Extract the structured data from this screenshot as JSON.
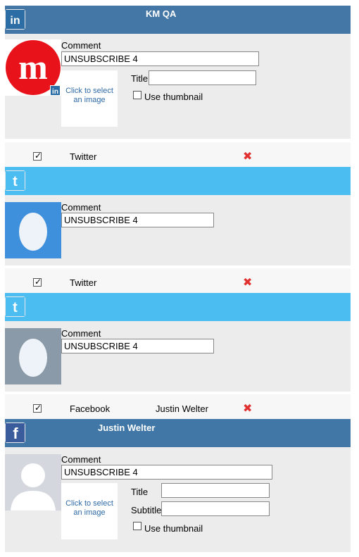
{
  "colors": {
    "linkedin_header": "#4477a5",
    "twitter_header": "#4bbdf0",
    "facebook_header": "#4077a6",
    "panel_bg": "#ececec",
    "remove_icon": "#e03030",
    "link_text": "#2e6aa6"
  },
  "posts": [
    {
      "network": "linkedin",
      "header_title": "KM QA",
      "comment_label": "Comment",
      "comment_value": "UNSUBSCRIBE 4",
      "image_picker": "Click to select an image",
      "title_label": "Title",
      "title_value": "",
      "use_thumbnail_label": "Use thumbnail",
      "use_thumbnail_checked": false,
      "avatar_icon": "m-logo-avatar",
      "network_badge_icon": "linkedin-badge-icon"
    },
    {
      "row": {
        "checked": true,
        "network_label": "Twitter",
        "account_name": "",
        "remove_icon": "remove-x-icon"
      },
      "network": "twitter",
      "header_title": "",
      "comment_label": "Comment",
      "comment_value": "UNSUBSCRIBE 4",
      "avatar_icon": "twitter-egg-avatar"
    },
    {
      "row": {
        "checked": true,
        "network_label": "Twitter",
        "account_name": "",
        "remove_icon": "remove-x-icon"
      },
      "network": "twitter",
      "header_title": "",
      "comment_label": "Comment",
      "comment_value": "UNSUBSCRIBE 4",
      "avatar_icon": "twitter-egg-avatar"
    },
    {
      "row": {
        "checked": true,
        "network_label": "Facebook",
        "account_name": "Justin Welter",
        "remove_icon": "remove-x-icon"
      },
      "network": "facebook",
      "header_title": "Justin Welter",
      "comment_label": "Comment",
      "comment_value": "UNSUBSCRIBE 4",
      "image_picker": "Click to select an image",
      "title_label": "Title",
      "title_value": "",
      "subtitle_label": "Subtitle",
      "subtitle_value": "",
      "use_thumbnail_label": "Use thumbnail",
      "use_thumbnail_checked": false,
      "avatar_icon": "facebook-default-avatar"
    }
  ]
}
